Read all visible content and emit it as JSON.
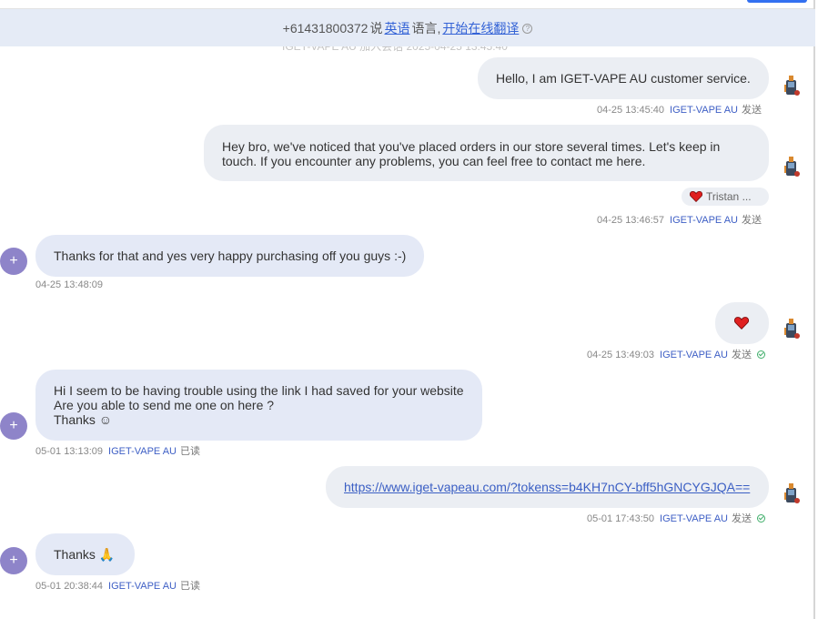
{
  "banner": {
    "phone": "+61431800372",
    "text_speaks": "说",
    "language": "英语",
    "text_language": "语言,",
    "translate_link": "开始在线翻译",
    "help": "?"
  },
  "ghost_text": "IGET-VAPE AU 加入会话 2025-04-25 13:45:40",
  "messages": [
    {
      "text": "Hello, I am IGET-VAPE AU customer service.",
      "time": "04-25 13:45:40",
      "sender": "IGET-VAPE AU",
      "status": "发送"
    },
    {
      "text": "Hey bro, we've noticed that you've placed orders in our store several times. Let's keep in touch. If you encounter any problems, you can feel free to contact me here.",
      "reaction": "Tristan ...",
      "time": "04-25 13:46:57",
      "sender": "IGET-VAPE AU",
      "status": "发送"
    },
    {
      "text": "Thanks for that and yes very happy purchasing off you guys :-)",
      "time": "04-25 13:48:09",
      "avatar": "+"
    },
    {
      "text": "❤️",
      "time": "04-25 13:49:03",
      "sender": "IGET-VAPE AU",
      "status": "发送"
    },
    {
      "line1": "Hi I seem to be having trouble using the link I had saved for your website",
      "line2": "Are you able to send me one on here ?",
      "line3": "Thanks ☺",
      "time": "05-01 13:13:09",
      "sender": "IGET-VAPE AU",
      "status": "已读",
      "avatar": "+"
    },
    {
      "text": "https://www.iget-vapeau.com/?tokenss=b4KH7nCY-bff5hGNCYGJQA==",
      "time": "05-01 17:43:50",
      "sender": "IGET-VAPE AU",
      "status": "发送"
    },
    {
      "text": "Thanks 🙏",
      "time": "05-01 20:38:44",
      "sender": "IGET-VAPE AU",
      "status": "已读",
      "avatar": "+"
    }
  ]
}
